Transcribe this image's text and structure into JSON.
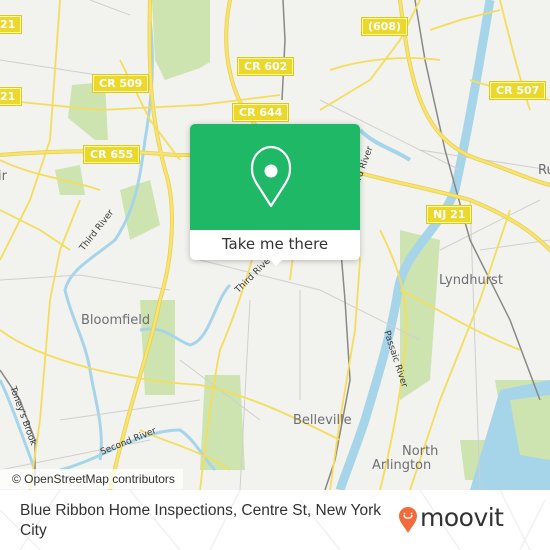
{
  "map": {
    "road_shields": [
      {
        "label": "CR 602"
      },
      {
        "label": "(608)"
      },
      {
        "label": "CR 509"
      },
      {
        "label": "21"
      },
      {
        "label": "21"
      },
      {
        "label": "CR 644"
      },
      {
        "label": "CR 507"
      },
      {
        "label": "CR 655"
      },
      {
        "label": "NJ 21"
      }
    ],
    "places": [
      {
        "label": "Bloomfield"
      },
      {
        "label": "Lyndhurst"
      },
      {
        "label": "Belleville"
      },
      {
        "label": "North"
      },
      {
        "label": "Arlington"
      },
      {
        "label": "Ru"
      },
      {
        "label": "ir"
      }
    ],
    "waterways": [
      {
        "label": "Third River"
      },
      {
        "label": "Third River"
      },
      {
        "label": "Passaic River"
      },
      {
        "label": "Second River"
      },
      {
        "label": "Toney's Brook"
      },
      {
        "label": "Third River"
      }
    ],
    "colors": {
      "land": "#f2f2ee",
      "road": "#f5dd5c",
      "water": "#a6d5ea",
      "park": "#cde4b0",
      "popup_green": "#1eb867"
    }
  },
  "popup": {
    "icon": "location-pin-icon",
    "button_label": "Take me there"
  },
  "attribution": "© OpenStreetMap contributors",
  "footer": {
    "title": "Blue Ribbon Home Inspections, Centre St, New York City",
    "logo_text": "moovit",
    "logo_icon": "moovit-pin-icon",
    "logo_color": "#f26b3a"
  }
}
